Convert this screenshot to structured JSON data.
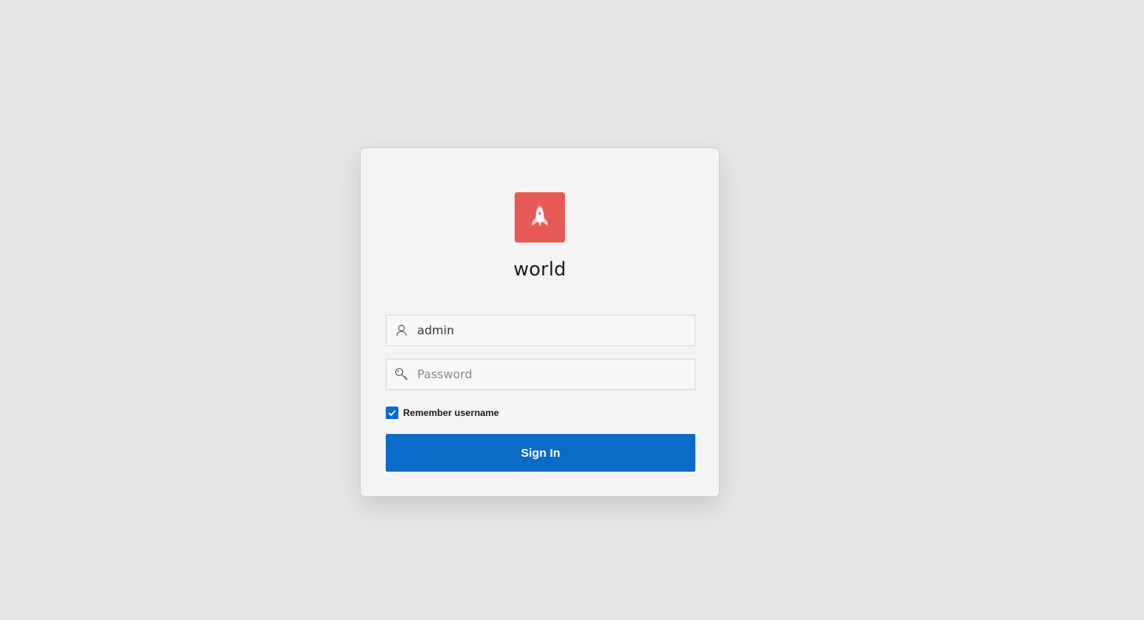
{
  "app": {
    "name": "world",
    "logo_icon": "rocket-icon",
    "logo_color": "#e85a57"
  },
  "login": {
    "username": {
      "icon": "user-icon",
      "value": "admin"
    },
    "password": {
      "icon": "key-icon",
      "value": "",
      "placeholder": "Password"
    },
    "remember": {
      "label": "Remember username",
      "checked": true
    },
    "submit_label": "Sign In"
  },
  "colors": {
    "accent": "#0a6bc9",
    "background": "#e6e6e6",
    "card": "#f4f4f4"
  }
}
